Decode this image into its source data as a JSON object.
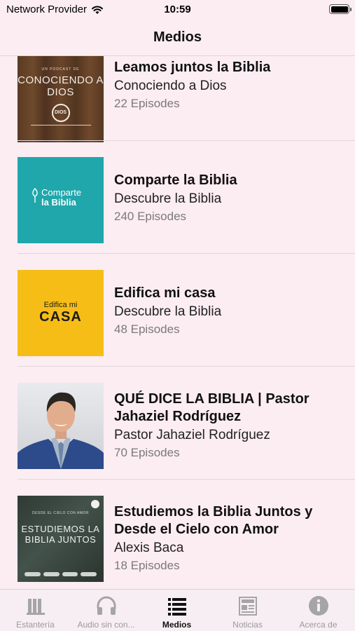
{
  "status_bar": {
    "carrier": "Network Provider",
    "time": "10:59"
  },
  "nav": {
    "title": "Medios"
  },
  "podcasts": [
    {
      "title": "Leamos juntos la Biblia",
      "author": "Conociendo a Dios",
      "episodes": "22 Episodes",
      "art": {
        "kicker": "UN PODCAST DE",
        "line1": "CONOCIENDO A",
        "line2": "DIOS",
        "badge": "DIOS"
      }
    },
    {
      "title": "Comparte la Biblia",
      "author": "Descubre la Biblia",
      "episodes": "240 Episodes",
      "art": {
        "line1": "Comparte",
        "line2": "la Biblia"
      }
    },
    {
      "title": "Edifica mi casa",
      "author": "Descubre la Biblia",
      "episodes": "48 Episodes",
      "art": {
        "line1": "Edifica mi",
        "line2": "CASA"
      }
    },
    {
      "title": "QUÉ DICE LA BIBLIA | Pastor Jahaziel Rodríguez",
      "author": "Pastor Jahaziel Rodríguez",
      "episodes": "70 Episodes",
      "art": {}
    },
    {
      "title": "Estudiemos la Biblia Juntos y Desde el Cielo con Amor",
      "author": "Alexis Baca",
      "episodes": "18 Episodes",
      "art": {
        "kicker": "DESDE EL CIELO CON AMOR",
        "line1": "ESTUDIEMOS LA",
        "line2": "BIBLIA JUNTOS"
      }
    }
  ],
  "tabs": [
    {
      "label": "Estantería",
      "icon": "bookshelf-icon",
      "active": false
    },
    {
      "label": "Audio sin con...",
      "icon": "headphones-icon",
      "active": false
    },
    {
      "label": "Medios",
      "icon": "list-icon",
      "active": true
    },
    {
      "label": "Noticias",
      "icon": "newspaper-icon",
      "active": false
    },
    {
      "label": "Acerca de",
      "icon": "info-icon",
      "active": false
    }
  ],
  "colors": {
    "background": "#fcedf3",
    "tab_inactive": "#9a9a9a",
    "tab_active": "#111111"
  }
}
